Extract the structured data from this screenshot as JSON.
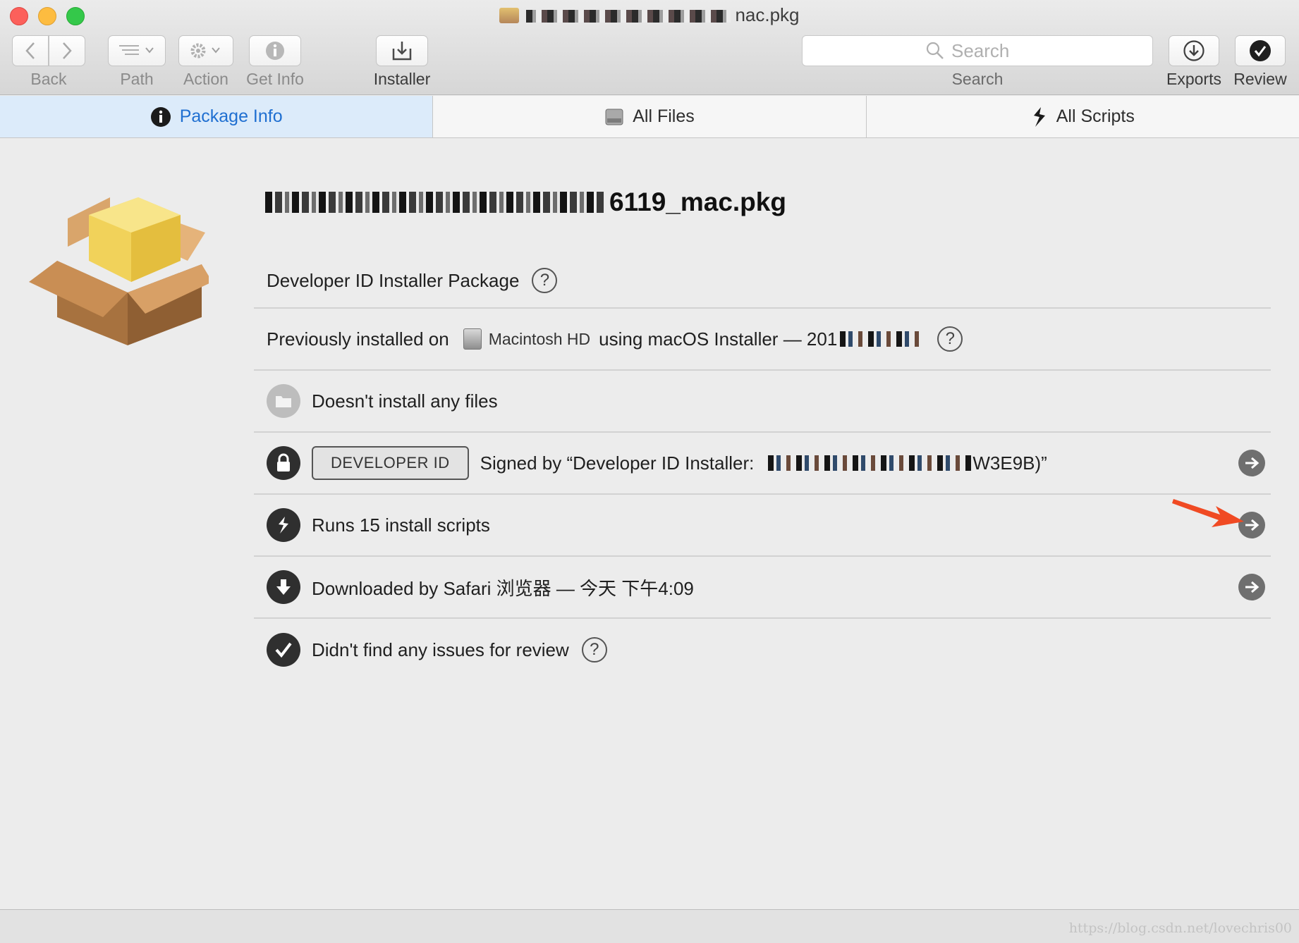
{
  "window": {
    "title_suffix": "nac.pkg"
  },
  "toolbar": {
    "back_label": "Back",
    "path_label": "Path",
    "action_label": "Action",
    "get_info_label": "Get Info",
    "installer_label": "Installer",
    "search_label": "Search",
    "search_placeholder": "Search",
    "exports_label": "Exports",
    "review_label": "Review"
  },
  "tabs": [
    {
      "label": "Package Info",
      "icon": "info-icon",
      "active": true
    },
    {
      "label": "All Files",
      "icon": "disk-icon",
      "active": false
    },
    {
      "label": "All Scripts",
      "icon": "script-icon",
      "active": false
    }
  ],
  "package": {
    "title_suffix": "6119_mac.pkg"
  },
  "rows": {
    "signature_type": "Developer ID Installer Package",
    "installed_prefix": "Previously installed on",
    "installed_disk": "Macintosh HD",
    "installed_suffix": "using macOS Installer — 201",
    "files": "Doesn't install any files",
    "developer_badge": "DEVELOPER ID",
    "signed_prefix": "Signed by “Developer ID Installer:",
    "signed_suffix": "W3E9B)”",
    "scripts": "Runs 15 install scripts",
    "downloaded": "Downloaded by Safari 浏览器 — 今天 下午4:09",
    "review": "Didn't find any issues for review"
  },
  "help_glyph": "?",
  "watermark": "https://blog.csdn.net/lovechris00",
  "colors": {
    "accent": "#1f6fd1",
    "active_tab_bg": "#dcebfa",
    "annotation_arrow": "#f04a23"
  }
}
